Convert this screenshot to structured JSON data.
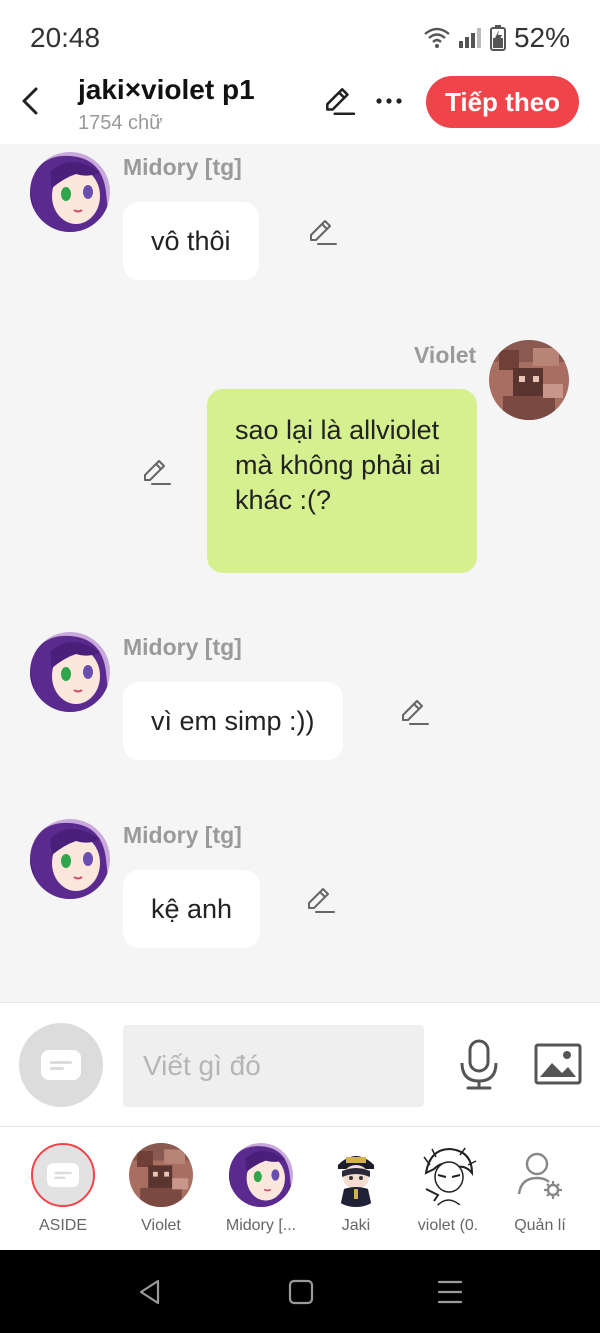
{
  "status_bar": {
    "time": "20:48",
    "battery": "52%",
    "icons": [
      "wifi-icon",
      "signal-icon",
      "battery-icon"
    ]
  },
  "header": {
    "title": "jaki×violet p1",
    "word_count": "1754 chữ",
    "next_label": "Tiếp theo",
    "accent_color": "#f0444b"
  },
  "messages": [
    {
      "sender": "Midory [tg]",
      "text": "vô thôi",
      "side": "left"
    },
    {
      "sender": "Violet",
      "text": "sao lại là allviolet mà không phải ai khác :(?",
      "side": "right",
      "bubble_color": "#d5f08e"
    },
    {
      "sender": "Midory [tg]",
      "text": "vì em simp :))",
      "side": "left"
    },
    {
      "sender": "Midory [tg]",
      "text": "kệ anh",
      "side": "left"
    }
  ],
  "input": {
    "placeholder": "Viết gì đó",
    "value": ""
  },
  "characters": [
    {
      "label": "ASIDE",
      "selected": true
    },
    {
      "label": "Violet",
      "selected": false
    },
    {
      "label": "Midory [...",
      "selected": false
    },
    {
      "label": "Jaki",
      "selected": false
    },
    {
      "label": "violet (0.",
      "selected": false
    },
    {
      "label": "Quản lí",
      "selected": false
    }
  ],
  "nav": {
    "icons": [
      "back-triangle-icon",
      "home-square-icon",
      "menu-lines-icon"
    ]
  }
}
